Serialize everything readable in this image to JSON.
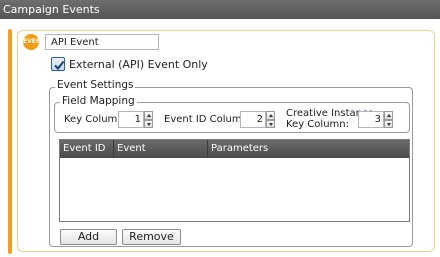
{
  "window": {
    "title": "Campaign Events"
  },
  "event": {
    "icon_text": "EVENT",
    "name_value": "API Event",
    "external_label": "External (API) Event Only",
    "external_checked": true
  },
  "settings": {
    "legend": "Event Settings",
    "field_mapping": {
      "legend": "Field Mapping",
      "key_column_label": "Key Column:",
      "key_column_value": "1",
      "event_id_column_label": "Event ID Column:",
      "event_id_column_value": "2",
      "creative_instance_label_line1": "Creative Instance",
      "creative_instance_label_line2": "Key Column:",
      "creative_instance_value": "3"
    },
    "grid": {
      "columns": [
        "Event ID",
        "Event",
        "Parameters"
      ],
      "rows": []
    },
    "buttons": {
      "add": "Add",
      "remove": "Remove"
    }
  },
  "colors": {
    "accent": "#f0a020",
    "header": "#555555"
  }
}
